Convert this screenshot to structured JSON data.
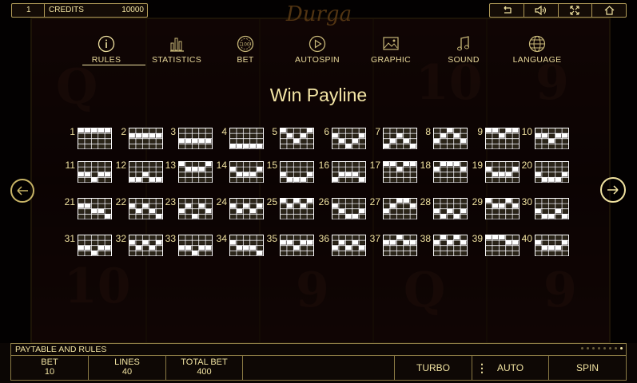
{
  "top": {
    "lines_value": "1",
    "credits_label": "CREDITS",
    "credits_value": "10000",
    "icons": [
      "back-arrow-icon",
      "sound-icon",
      "fullscreen-icon",
      "home-icon"
    ]
  },
  "logo": "Durga",
  "tabs": [
    {
      "label": "RULES",
      "icon": "info-icon",
      "active": true
    },
    {
      "label": "STATISTICS",
      "icon": "bar-chart-icon",
      "active": false
    },
    {
      "label": "BET",
      "icon": "chip-icon",
      "active": false
    },
    {
      "label": "AUTOSPIN",
      "icon": "play-circle-icon",
      "active": false
    },
    {
      "label": "GRAPHIC",
      "icon": "image-icon",
      "active": false
    },
    {
      "label": "SOUND",
      "icon": "music-note-icon",
      "active": false
    },
    {
      "label": "LANGUAGE",
      "icon": "globe-icon",
      "active": false
    }
  ],
  "bet_chip_text": "100",
  "title": "Win Payline",
  "paylines": [
    {
      "n": "1",
      "rows": [
        0,
        0,
        0,
        0,
        0
      ]
    },
    {
      "n": "2",
      "rows": [
        1,
        1,
        1,
        1,
        1
      ]
    },
    {
      "n": "3",
      "rows": [
        2,
        2,
        2,
        2,
        2
      ]
    },
    {
      "n": "4",
      "rows": [
        3,
        3,
        3,
        3,
        3
      ]
    },
    {
      "n": "5",
      "rows": [
        0,
        1,
        2,
        1,
        0
      ]
    },
    {
      "n": "6",
      "rows": [
        1,
        2,
        3,
        2,
        1
      ]
    },
    {
      "n": "7",
      "rows": [
        3,
        2,
        1,
        2,
        3
      ]
    },
    {
      "n": "8",
      "rows": [
        2,
        1,
        0,
        1,
        2
      ]
    },
    {
      "n": "9",
      "rows": [
        0,
        0,
        1,
        0,
        0
      ]
    },
    {
      "n": "10",
      "rows": [
        1,
        1,
        2,
        1,
        1
      ]
    },
    {
      "n": "11",
      "rows": [
        2,
        2,
        3,
        2,
        2
      ]
    },
    {
      "n": "12",
      "rows": [
        3,
        3,
        2,
        3,
        3
      ]
    },
    {
      "n": "13",
      "rows": [
        0,
        1,
        1,
        1,
        0
      ]
    },
    {
      "n": "14",
      "rows": [
        1,
        2,
        2,
        2,
        1
      ]
    },
    {
      "n": "15",
      "rows": [
        2,
        3,
        3,
        3,
        2
      ]
    },
    {
      "n": "16",
      "rows": [
        3,
        2,
        2,
        2,
        3
      ]
    },
    {
      "n": "17",
      "rows": [
        0,
        0,
        1,
        0,
        0
      ]
    },
    {
      "n": "18",
      "rows": [
        1,
        0,
        0,
        0,
        1
      ]
    },
    {
      "n": "19",
      "rows": [
        1,
        2,
        2,
        2,
        1
      ]
    },
    {
      "n": "20",
      "rows": [
        2,
        3,
        3,
        3,
        2
      ]
    },
    {
      "n": "21",
      "rows": [
        1,
        1,
        2,
        2,
        3
      ]
    },
    {
      "n": "22",
      "rows": [
        1,
        2,
        1,
        2,
        3
      ]
    },
    {
      "n": "23",
      "rows": [
        2,
        1,
        3,
        1,
        2
      ]
    },
    {
      "n": "24",
      "rows": [
        1,
        2,
        1,
        2,
        1
      ]
    },
    {
      "n": "25",
      "rows": [
        0,
        1,
        0,
        1,
        0
      ]
    },
    {
      "n": "26",
      "rows": [
        1,
        2,
        3,
        3,
        2
      ]
    },
    {
      "n": "27",
      "rows": [
        2,
        1,
        0,
        0,
        1
      ]
    },
    {
      "n": "28",
      "rows": [
        2,
        3,
        2,
        3,
        2
      ]
    },
    {
      "n": "29",
      "rows": [
        0,
        1,
        1,
        0,
        1
      ]
    },
    {
      "n": "30",
      "rows": [
        2,
        3,
        3,
        2,
        3
      ]
    },
    {
      "n": "31",
      "rows": [
        2,
        2,
        3,
        2,
        2
      ]
    },
    {
      "n": "32",
      "rows": [
        1,
        2,
        1,
        2,
        1
      ]
    },
    {
      "n": "33",
      "rows": [
        2,
        2,
        3,
        2,
        2
      ]
    },
    {
      "n": "34",
      "rows": [
        1,
        2,
        2,
        2,
        3
      ]
    },
    {
      "n": "35",
      "rows": [
        1,
        1,
        2,
        1,
        1
      ]
    },
    {
      "n": "36",
      "rows": [
        2,
        1,
        2,
        1,
        2
      ]
    },
    {
      "n": "37",
      "rows": [
        1,
        1,
        0,
        1,
        1
      ]
    },
    {
      "n": "38",
      "rows": [
        1,
        0,
        1,
        0,
        1
      ]
    },
    {
      "n": "39",
      "rows": [
        0,
        0,
        0,
        1,
        1
      ]
    },
    {
      "n": "40",
      "rows": [
        1,
        2,
        2,
        2,
        1
      ]
    }
  ],
  "bottom": {
    "paytable_label": "PAYTABLE AND RULES",
    "page_dots": 8,
    "active_dot": 7,
    "bet_label": "BET",
    "bet_value": "10",
    "lines_label": "LINES",
    "lines_value": "40",
    "total_label": "TOTAL BET",
    "total_value": "400",
    "turbo_label": "TURBO",
    "auto_label": "AUTO",
    "spin_label": "SPIN"
  },
  "colors": {
    "accent": "#f0e2a0",
    "border": "#8a7a44",
    "cell_on": "#ffffff",
    "cell_off": "#2a2418"
  }
}
